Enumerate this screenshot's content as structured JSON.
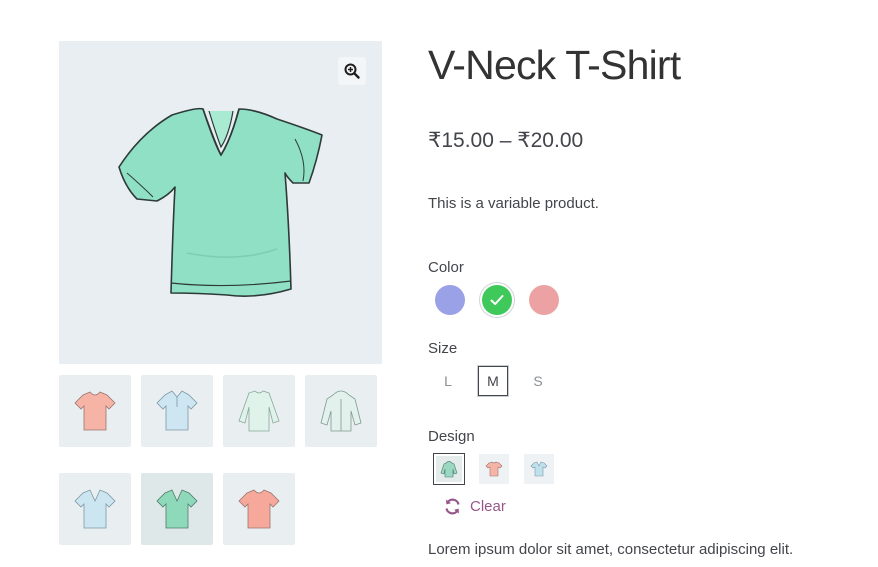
{
  "product": {
    "title": "V-Neck T-Shirt",
    "price": "₹15.00 – ₹20.00",
    "description": "This is a variable product.",
    "short_text": "Lorem ipsum dolor sit amet, consectetur adipiscing elit."
  },
  "attributes": {
    "color": {
      "label": "Color",
      "options": [
        {
          "name": "blue",
          "hex": "#9aa1e6",
          "selected": false
        },
        {
          "name": "green",
          "hex": "#3fc95a",
          "selected": true
        },
        {
          "name": "red",
          "hex": "#eca2a2",
          "selected": false
        }
      ]
    },
    "size": {
      "label": "Size",
      "options": [
        {
          "label": "L",
          "selected": false
        },
        {
          "label": "M",
          "selected": true
        },
        {
          "label": "S",
          "selected": false
        }
      ]
    },
    "design": {
      "label": "Design",
      "options": [
        {
          "name": "hoodie-green",
          "selected": true
        },
        {
          "name": "tshirt-pink",
          "selected": false
        },
        {
          "name": "tshirt-blue",
          "selected": false
        }
      ]
    },
    "clear_label": "Clear"
  },
  "gallery": {
    "thumbnails": [
      "tshirt-pink",
      "polo-blue",
      "long-sleeve-green",
      "hoodie-green",
      "vneck-blue",
      "vneck-green",
      "tshirt-pink"
    ],
    "active_thumbnail": 5
  },
  "colors": {
    "accent": "#96588a",
    "shirt_green": "#8fe0c4",
    "image_bg": "#e8eef2"
  },
  "icons": {
    "zoom": "zoom-in-icon",
    "clear": "refresh-icon",
    "check": "check-icon"
  }
}
